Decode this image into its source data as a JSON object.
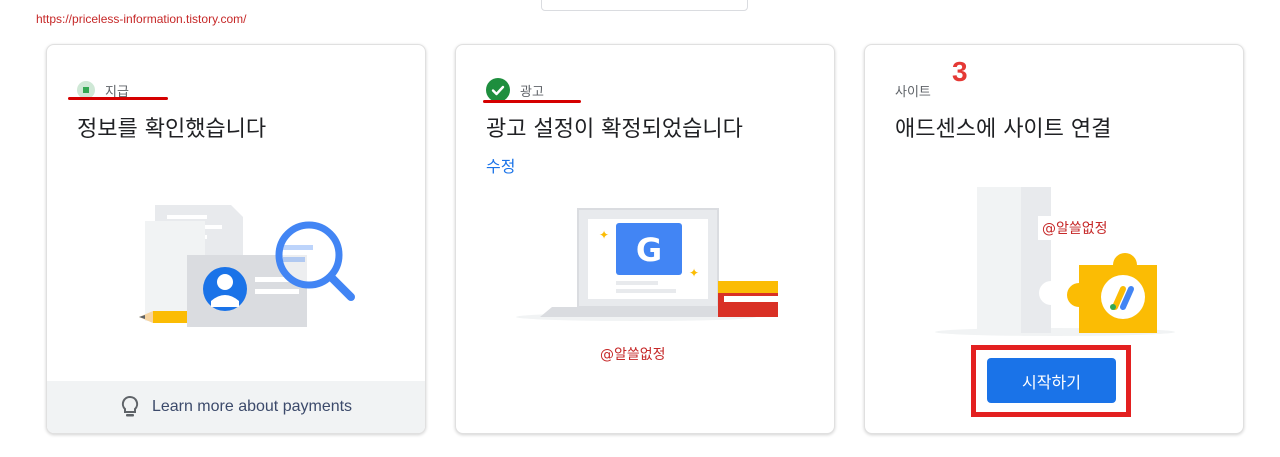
{
  "watermark_url": "https://priceless-information.tistory.com/",
  "watermark_handle": "@알쓸없정",
  "step_number": "3",
  "cards": [
    {
      "status": "지급",
      "title": "정보를 확인했습니다",
      "footer_text": "Learn more about payments",
      "illustration": "document-search-illustration"
    },
    {
      "status": "광고",
      "title": "광고 설정이 확정되었습니다",
      "edit_link": "수정",
      "illustration": "laptop-google-illustration"
    },
    {
      "status": "사이트",
      "title": "애드센스에 사이트 연결",
      "button_label": "시작하기",
      "illustration": "puzzle-adsense-illustration"
    }
  ],
  "colors": {
    "accent": "#1a73e8",
    "annotation_red": "#e32020",
    "success_green": "#1e8e3e"
  }
}
